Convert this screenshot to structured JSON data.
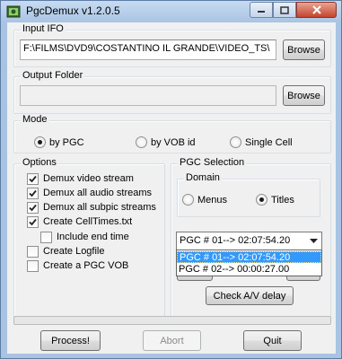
{
  "window": {
    "title": "PgcDemux v1.2.0.5"
  },
  "input_ifo": {
    "legend": "Input IFO",
    "value": "F:\\FILMS\\DVD9\\COSTANTINO IL GRANDE\\VIDEO_TS\\",
    "browse_label": "Browse"
  },
  "output_folder": {
    "legend": "Output Folder",
    "value": "",
    "browse_label": "Browse"
  },
  "mode": {
    "legend": "Mode",
    "options": [
      "by PGC",
      "by VOB id",
      "Single Cell"
    ],
    "selected": "by PGC"
  },
  "options": {
    "legend": "Options",
    "items": [
      {
        "label": "Demux video stream",
        "checked": true
      },
      {
        "label": "Demux all audio streams",
        "checked": true
      },
      {
        "label": "Demux all subpic streams",
        "checked": true
      },
      {
        "label": "Create CellTimes.txt",
        "checked": true
      },
      {
        "label": "Include end time",
        "checked": false
      },
      {
        "label": "Create Logfile",
        "checked": false
      },
      {
        "label": "Create a PGC VOB",
        "checked": false
      }
    ]
  },
  "pgc_selection": {
    "legend": "PGC Selection",
    "domain": {
      "legend": "Domain",
      "options": [
        "Menus",
        "Titles"
      ],
      "selected": "Titles"
    },
    "combo_value": "PGC # 01--> 02:07:54.20",
    "dropdown_items": [
      "PGC # 01--> 02:07:54.20",
      "PGC # 02--> 00:00:27.00"
    ],
    "dropdown_selected_index": 0,
    "check_av_label": "Check A/V delay"
  },
  "buttons": {
    "process": "Process!",
    "abort": "Abort",
    "quit": "Quit"
  }
}
